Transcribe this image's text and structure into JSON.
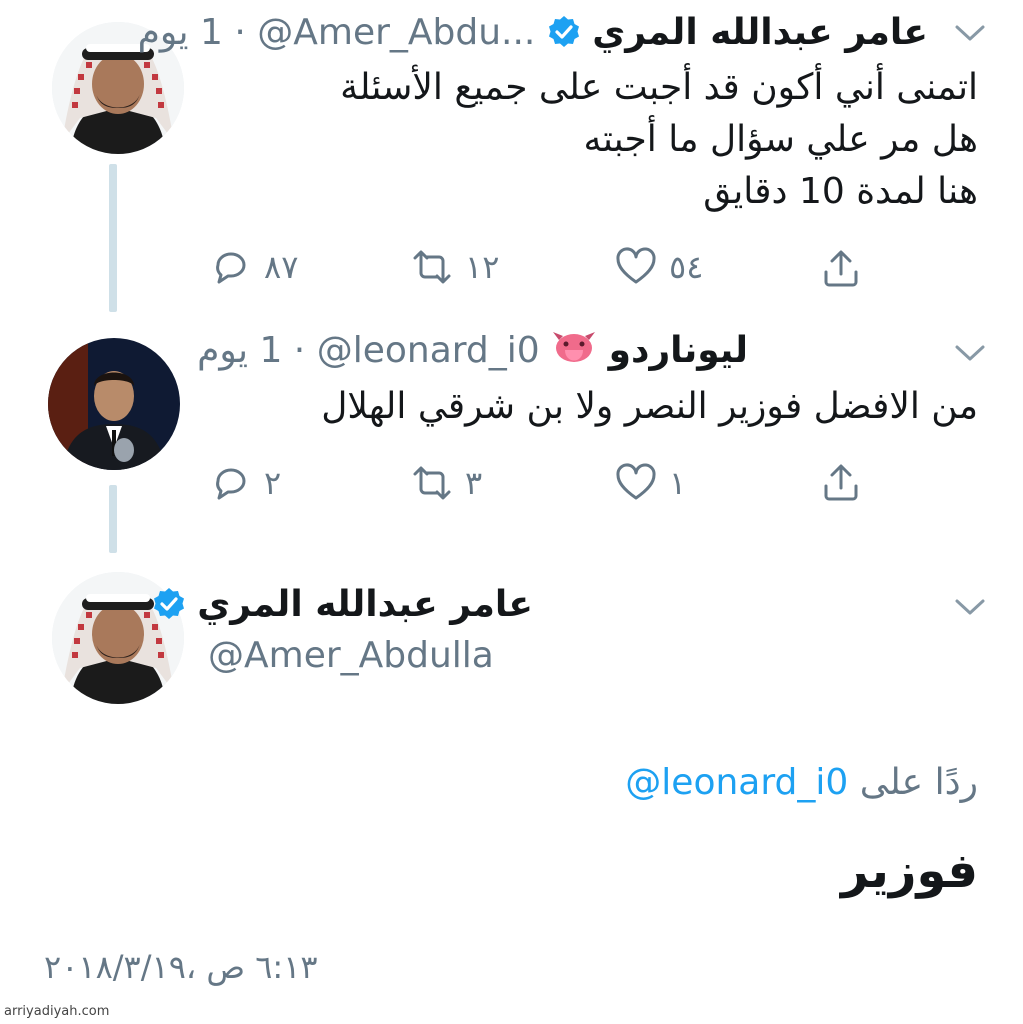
{
  "tweets": [
    {
      "name": "عامر عبدالله المري",
      "handle": "@Amer_Abdu...",
      "time": "1 يوم",
      "sep": " · ",
      "lines": [
        "اتمنى أني أكون قد أجبت على جميع الأسئلة",
        "هل مر علي سؤال ما أجبته",
        "هنا لمدة 10 دقايق"
      ],
      "replies": "٨٧",
      "retweets": "١٢",
      "likes": "٥٤"
    },
    {
      "name": "ليوناردو",
      "handle": "@leonard_i0",
      "time": "1 يوم",
      "sep": " · ",
      "lines": [
        "من الافضل فوزير النصر ولا بن شرقي الهلال"
      ],
      "replies": "٢",
      "retweets": "٣",
      "likes": "١"
    }
  ],
  "main_tweet": {
    "name": "عامر عبدالله المري",
    "handle": "@Amer_Abdulla",
    "reply_to_label": "ردًا على",
    "reply_to_handle": "@leonard_i0",
    "text": "فوزير",
    "timestamp": "٦:١٣ ص ،٢٠١٨/٣/١٩"
  },
  "watermark": "arriyadiyah.com",
  "colors": {
    "accent": "#1da1f2",
    "text": "#14171a",
    "muted": "#657786",
    "thread_line": "#cfe0e8"
  },
  "icons": [
    "reply-icon",
    "retweet-icon",
    "like-icon",
    "share-icon",
    "verified-icon",
    "chevron-down-icon",
    "tongue-emoji-icon"
  ]
}
